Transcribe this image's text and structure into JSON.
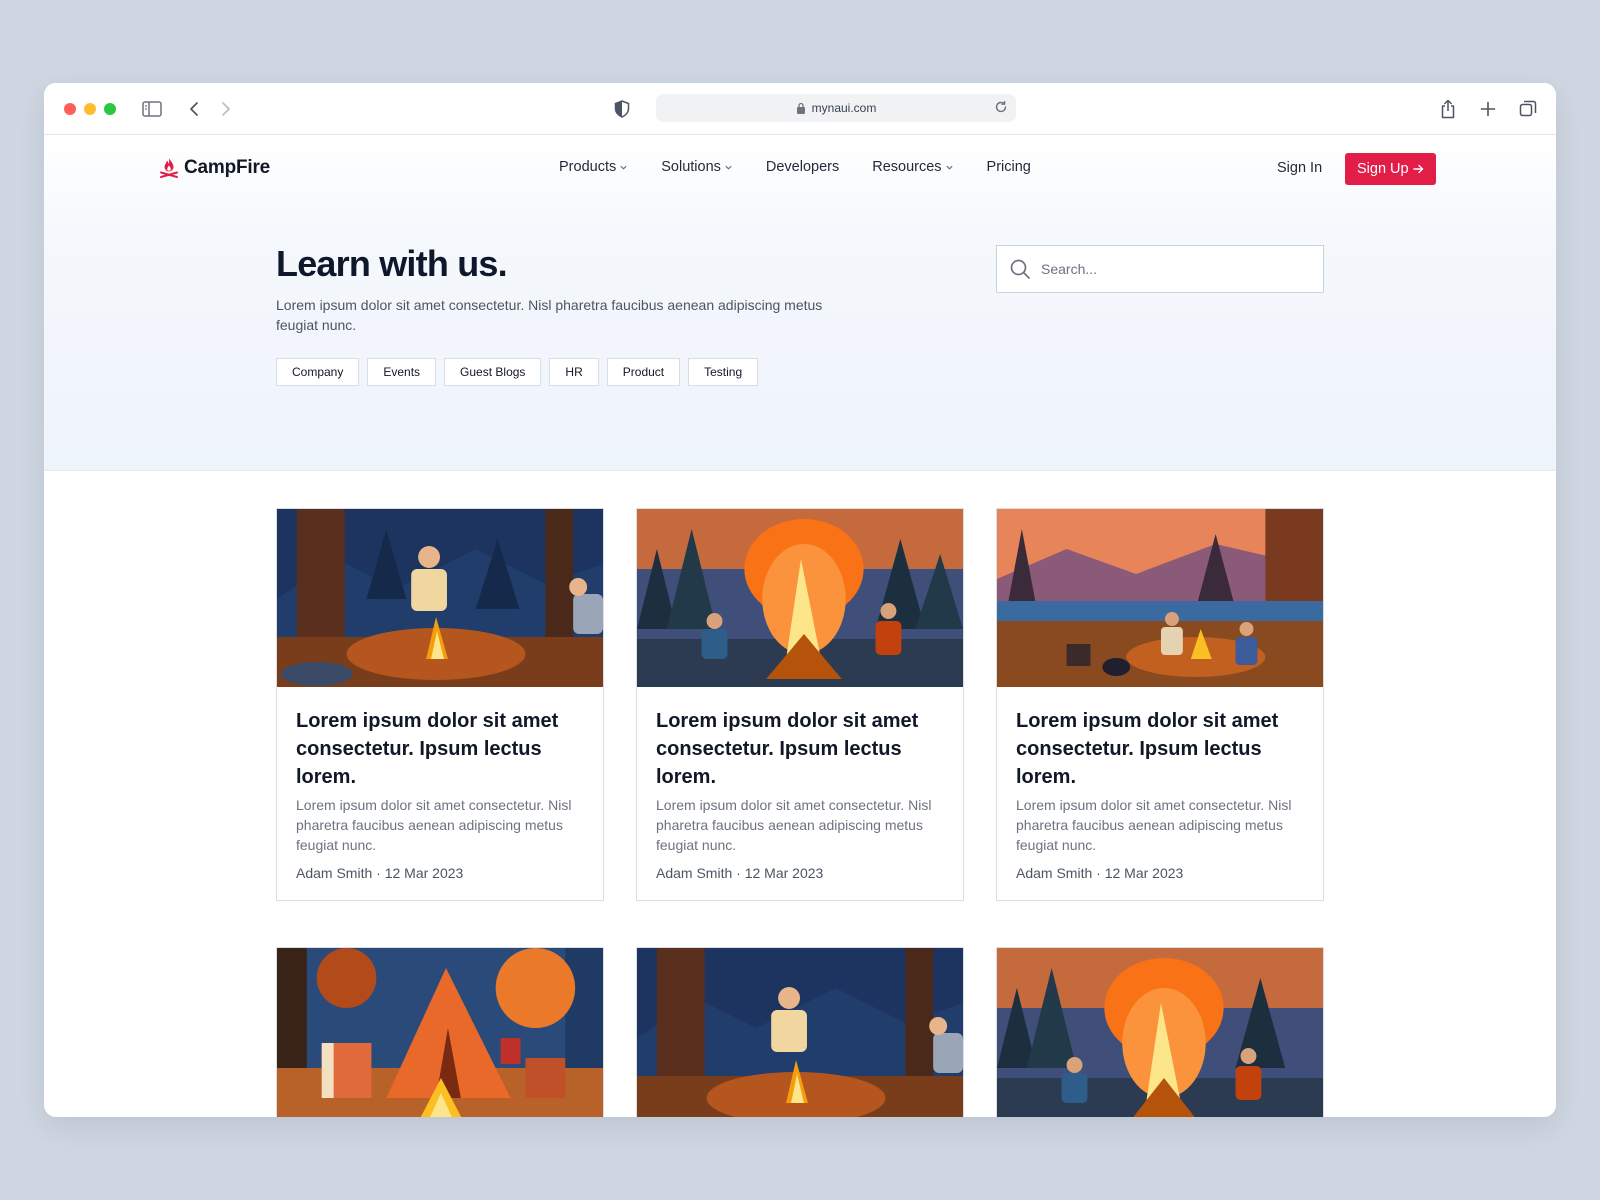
{
  "browser": {
    "url": "mynaui.com"
  },
  "nav": {
    "brand": "CampFire",
    "items": [
      {
        "label": "Products",
        "dropdown": true
      },
      {
        "label": "Solutions",
        "dropdown": true
      },
      {
        "label": "Developers",
        "dropdown": false
      },
      {
        "label": "Resources",
        "dropdown": true
      },
      {
        "label": "Pricing",
        "dropdown": false
      }
    ],
    "sign_in": "Sign In",
    "sign_up": "Sign Up",
    "accent": "#e11d48"
  },
  "hero": {
    "title": "Learn with us.",
    "description": "Lorem ipsum dolor sit amet consectetur. Nisl pharetra faucibus aenean adipiscing metus feugiat nunc.",
    "search_placeholder": "Search...",
    "tags": [
      "Company",
      "Events",
      "Guest Blogs",
      "HR",
      "Product",
      "Testing"
    ]
  },
  "posts": [
    {
      "title": "Lorem ipsum dolor sit amet consectetur. Ipsum lectus lorem.",
      "excerpt": "Lorem ipsum dolor sit amet consectetur. Nisl pharetra faucibus aenean adipiscing metus feugiat nunc.",
      "author": "Adam Smith",
      "date": "12 Mar 2023",
      "image": "campfire-forest-night"
    },
    {
      "title": "Lorem ipsum dolor sit amet consectetur. Ipsum lectus lorem.",
      "excerpt": "Lorem ipsum dolor sit amet consectetur. Nisl pharetra faucibus aenean adipiscing metus feugiat nunc.",
      "author": "Adam Smith",
      "date": "12 Mar 2023",
      "image": "bonfire-big-flames"
    },
    {
      "title": "Lorem ipsum dolor sit amet consectetur. Ipsum lectus lorem.",
      "excerpt": "Lorem ipsum dolor sit amet consectetur. Nisl pharetra faucibus aenean adipiscing metus feugiat nunc.",
      "author": "Adam Smith",
      "date": "12 Mar 2023",
      "image": "lakeside-camp-sunset"
    },
    {
      "image": "tent-and-chairs"
    },
    {
      "image": "campfire-forest-night"
    },
    {
      "image": "bonfire-big-flames"
    }
  ]
}
